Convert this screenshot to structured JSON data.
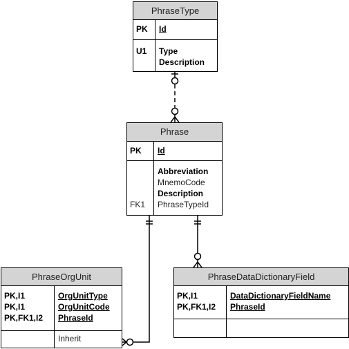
{
  "entities": {
    "phrase_type": {
      "title": "PhraseType",
      "pk_section": {
        "keys": [
          "PK"
        ],
        "fields": [
          "Id"
        ]
      },
      "attr_section": {
        "keys": [
          "U1",
          ""
        ],
        "fields": [
          "Type",
          "Description"
        ]
      }
    },
    "phrase": {
      "title": "Phrase",
      "pk_section": {
        "keys": [
          "PK"
        ],
        "fields": [
          "Id"
        ]
      },
      "attr_section": {
        "keys": [
          "",
          "",
          "",
          "FK1"
        ],
        "fields": [
          "Abbreviation",
          "MnemoCode",
          "Description",
          "PhraseTypeId"
        ]
      }
    },
    "phrase_org_unit": {
      "title": "PhraseOrgUnit",
      "pk_section": {
        "keys": [
          "PK,I1",
          "PK,I1",
          "PK,FK1,I2"
        ],
        "fields": [
          "OrgUnitType",
          "OrgUnitCode",
          "PhraseId"
        ]
      },
      "attr_section": {
        "keys": [
          ""
        ],
        "fields": [
          "Inherit"
        ]
      }
    },
    "phrase_data_dictionary_field": {
      "title": "PhraseDataDictionaryField",
      "pk_section": {
        "keys": [
          "PK,I1",
          "PK,FK1,I2"
        ],
        "fields": [
          "DataDictionaryFieldName",
          "PhraseId"
        ]
      },
      "attr_section": {
        "keys": [
          ""
        ],
        "fields": [
          ""
        ]
      }
    }
  },
  "relationships": [
    {
      "from": "PhraseType",
      "to": "Phrase",
      "from_cardinality": "one-optional",
      "to_cardinality": "zero-or-many",
      "style": "dashed"
    },
    {
      "from": "Phrase",
      "to": "PhraseOrgUnit",
      "from_cardinality": "exactly-one",
      "to_cardinality": "zero-or-many",
      "style": "solid"
    },
    {
      "from": "Phrase",
      "to": "PhraseDataDictionaryField",
      "from_cardinality": "exactly-one",
      "to_cardinality": "zero-or-many",
      "style": "solid"
    }
  ]
}
